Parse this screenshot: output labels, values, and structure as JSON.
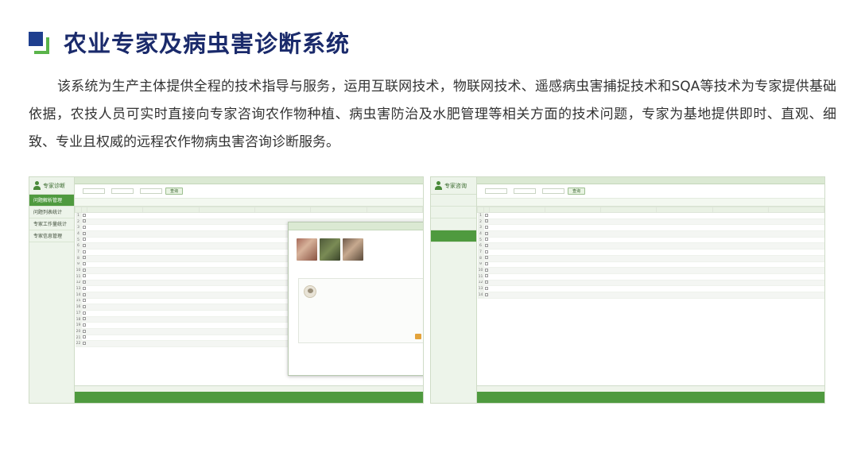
{
  "header": {
    "title": "农业专家及病虫害诊断系统"
  },
  "intro": {
    "text": "该系统为生产主体提供全程的技术指导与服务，运用互联网技术，物联网技术、遥感病虫害捕捉技术和SQA等技术为专家提供基础依据，农技人员可实时直接向专家咨询农作物种植、病虫害防治及水肥管理等相关方面的技术问题，专家为基地提供即时、直观、细致、专业且权威的远程农作物病虫害咨询诊断服务。"
  },
  "screenshot_left": {
    "logo_text": "专家诊断",
    "nav": [
      "问题解析管理",
      "问题列表统计",
      "专家工作量统计",
      "专家信息管理"
    ],
    "crumb": "",
    "search": {
      "btn": "查询"
    },
    "toolbar": {
      "add": "",
      "del": ""
    },
    "table": {
      "headers": [
        "",
        "",
        "",
        "",
        "",
        "",
        "",
        ""
      ],
      "rows": [
        [
          "1",
          "",
          "",
          "",
          "",
          "",
          "",
          ""
        ],
        [
          "2",
          "",
          "",
          "",
          "",
          "",
          "",
          ""
        ],
        [
          "3",
          "",
          "",
          "",
          "",
          "",
          "",
          ""
        ],
        [
          "4",
          "",
          "",
          "",
          "",
          "",
          "",
          ""
        ],
        [
          "5",
          "",
          "",
          "",
          "",
          "",
          "",
          ""
        ],
        [
          "6",
          "",
          "",
          "",
          "",
          "",
          "",
          ""
        ],
        [
          "7",
          "",
          "",
          "",
          "",
          "",
          "",
          ""
        ],
        [
          "8",
          "",
          "",
          "",
          "",
          "",
          "",
          ""
        ],
        [
          "9",
          "",
          "",
          "",
          "",
          "",
          "",
          ""
        ],
        [
          "10",
          "",
          "",
          "",
          "",
          "",
          "",
          ""
        ],
        [
          "11",
          "",
          "",
          "",
          "",
          "",
          "",
          ""
        ],
        [
          "12",
          "",
          "",
          "",
          "",
          "",
          "",
          ""
        ],
        [
          "13",
          "",
          "",
          "",
          "",
          "",
          "",
          ""
        ],
        [
          "14",
          "",
          "",
          "",
          "",
          "",
          "",
          ""
        ],
        [
          "15",
          "",
          "",
          "",
          "",
          "",
          "",
          ""
        ],
        [
          "16",
          "",
          "",
          "",
          "",
          "",
          "",
          ""
        ],
        [
          "17",
          "",
          "",
          "",
          "",
          "",
          "",
          ""
        ],
        [
          "18",
          "",
          "",
          "",
          "",
          "",
          "",
          ""
        ],
        [
          "19",
          "",
          "",
          "",
          "",
          "",
          "",
          ""
        ],
        [
          "20",
          "",
          "",
          "",
          "",
          "",
          "",
          ""
        ],
        [
          "21",
          "",
          "",
          "",
          "",
          "",
          "",
          ""
        ],
        [
          "22",
          "",
          "",
          "",
          "",
          "",
          "",
          ""
        ]
      ]
    },
    "pager": {
      "left": "",
      "right": ""
    },
    "footer": "",
    "dialog": {
      "title": "",
      "question_line1": "",
      "question_line2": "",
      "question_line3": "",
      "datetime": "",
      "reply_name": "",
      "reply_meta": "",
      "reply_text": "",
      "reply_date": ""
    }
  },
  "screenshot_right": {
    "logo_text": "专家咨询",
    "nav": [
      "",
      "",
      "",
      ""
    ],
    "crumb": "",
    "search": {
      "btn": "查询"
    },
    "toolbar": {
      "add": "",
      "edit": "",
      "del": "",
      "export": ""
    },
    "table": {
      "headers": [
        "",
        "",
        "",
        "",
        "",
        "",
        "",
        ""
      ],
      "rows": [
        [
          "1",
          "",
          "",
          "",
          "",
          "",
          "",
          ""
        ],
        [
          "2",
          "",
          "",
          "",
          "",
          "",
          "",
          ""
        ],
        [
          "3",
          "",
          "",
          "",
          "",
          "",
          "",
          ""
        ],
        [
          "4",
          "",
          "",
          "",
          "",
          "",
          "",
          ""
        ],
        [
          "5",
          "",
          "",
          "",
          "",
          "",
          "",
          ""
        ],
        [
          "6",
          "",
          "",
          "",
          "",
          "",
          "",
          ""
        ],
        [
          "7",
          "",
          "",
          "",
          "",
          "",
          "",
          ""
        ],
        [
          "8",
          "",
          "",
          "",
          "",
          "",
          "",
          ""
        ],
        [
          "9",
          "",
          "",
          "",
          "",
          "",
          "",
          ""
        ],
        [
          "10",
          "",
          "",
          "",
          "",
          "",
          "",
          ""
        ],
        [
          "11",
          "",
          "",
          "",
          "",
          "",
          "",
          ""
        ],
        [
          "12",
          "",
          "",
          "",
          "",
          "",
          "",
          ""
        ],
        [
          "13",
          "",
          "",
          "",
          "",
          "",
          "",
          ""
        ],
        [
          "14",
          "",
          "",
          "",
          "",
          "",
          "",
          ""
        ]
      ]
    },
    "pager": {
      "left": "",
      "right": ""
    },
    "footer": ""
  },
  "colors": {
    "navy": "#1a2a6b",
    "green": "#4f9a3f",
    "accent_green": "#5ab44a"
  }
}
